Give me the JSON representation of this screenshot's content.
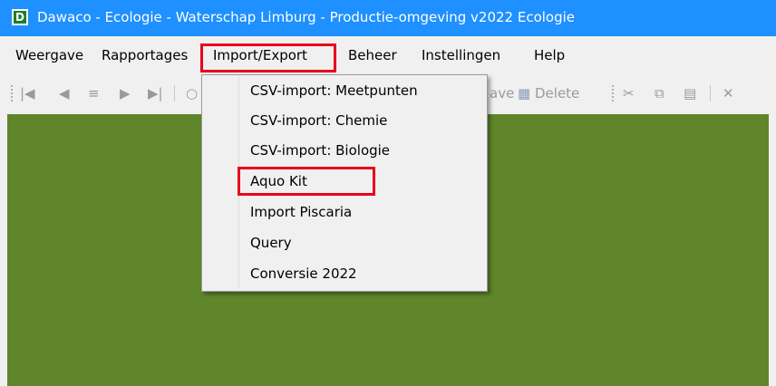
{
  "window": {
    "title": "Dawaco - Ecologie - Waterschap Limburg - Productie-omgeving v2022 Ecologie",
    "app_icon_letter": "D"
  },
  "menubar": {
    "items": [
      "Weergave",
      "Rapportages",
      "Import/Export",
      "Beheer",
      "Instellingen",
      "Help"
    ],
    "active": "Import/Export"
  },
  "toolbar": {
    "glyphs": {
      "first": "|◀",
      "prev": "◀",
      "list": "≡",
      "next": "▶",
      "last": "▶|",
      "circle": "○"
    },
    "save_label_partial": "ave",
    "delete_label": "Delete",
    "close_glyph": "✕"
  },
  "dropdown": {
    "items": [
      "CSV-import: Meetpunten",
      "CSV-import: Chemie",
      "CSV-import: Biologie",
      "Aquo Kit",
      "Import Piscaria",
      "Query",
      "Conversie 2022"
    ]
  },
  "colors": {
    "titlebar": "#1e90ff",
    "content_bg": "#5f862a",
    "highlight": "#e8001c"
  }
}
